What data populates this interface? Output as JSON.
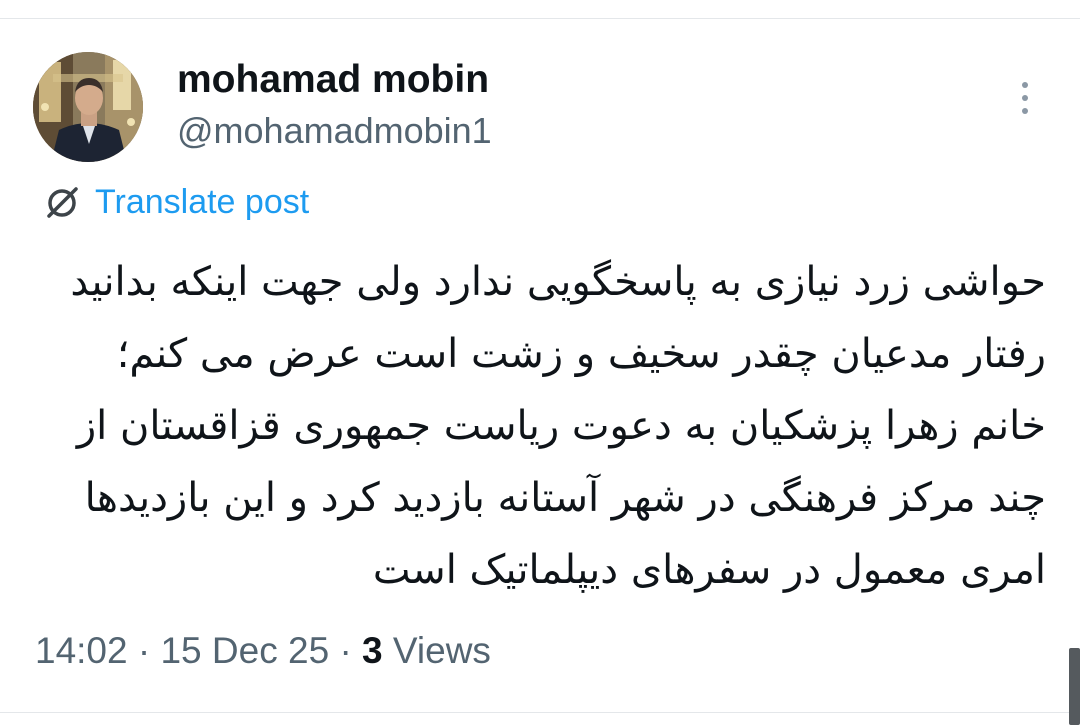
{
  "post": {
    "author": {
      "display_name": "mohamad mobin",
      "handle": "@mohamadmobin1",
      "avatar_icon": "profile-photo-icon"
    },
    "more_icon": "more-vertical-icon",
    "translate": {
      "icon": "translate-globe-icon",
      "label": "Translate post"
    },
    "text": "حواشی زرد نیازی به پاسخگویی ندارد ولی جهت اینکه بدانید رفتار مدعیان چقدر سخیف و زشت است عرض می کنم؛ خانم زهرا پزشکیان به دعوت ریاست جمهوری قزاقستان از چند مرکز فرهنگی در شهر آستانه بازدید کرد و این بازدیدها امری معمول در سفرهای دیپلماتیک است",
    "meta": {
      "time": "14:02",
      "date": "15 Dec 25",
      "separator": "·",
      "views_count": "3",
      "views_label": "Views"
    }
  },
  "colors": {
    "link": "#1d9bf0",
    "text": "#0f1419",
    "muted": "#536471"
  }
}
